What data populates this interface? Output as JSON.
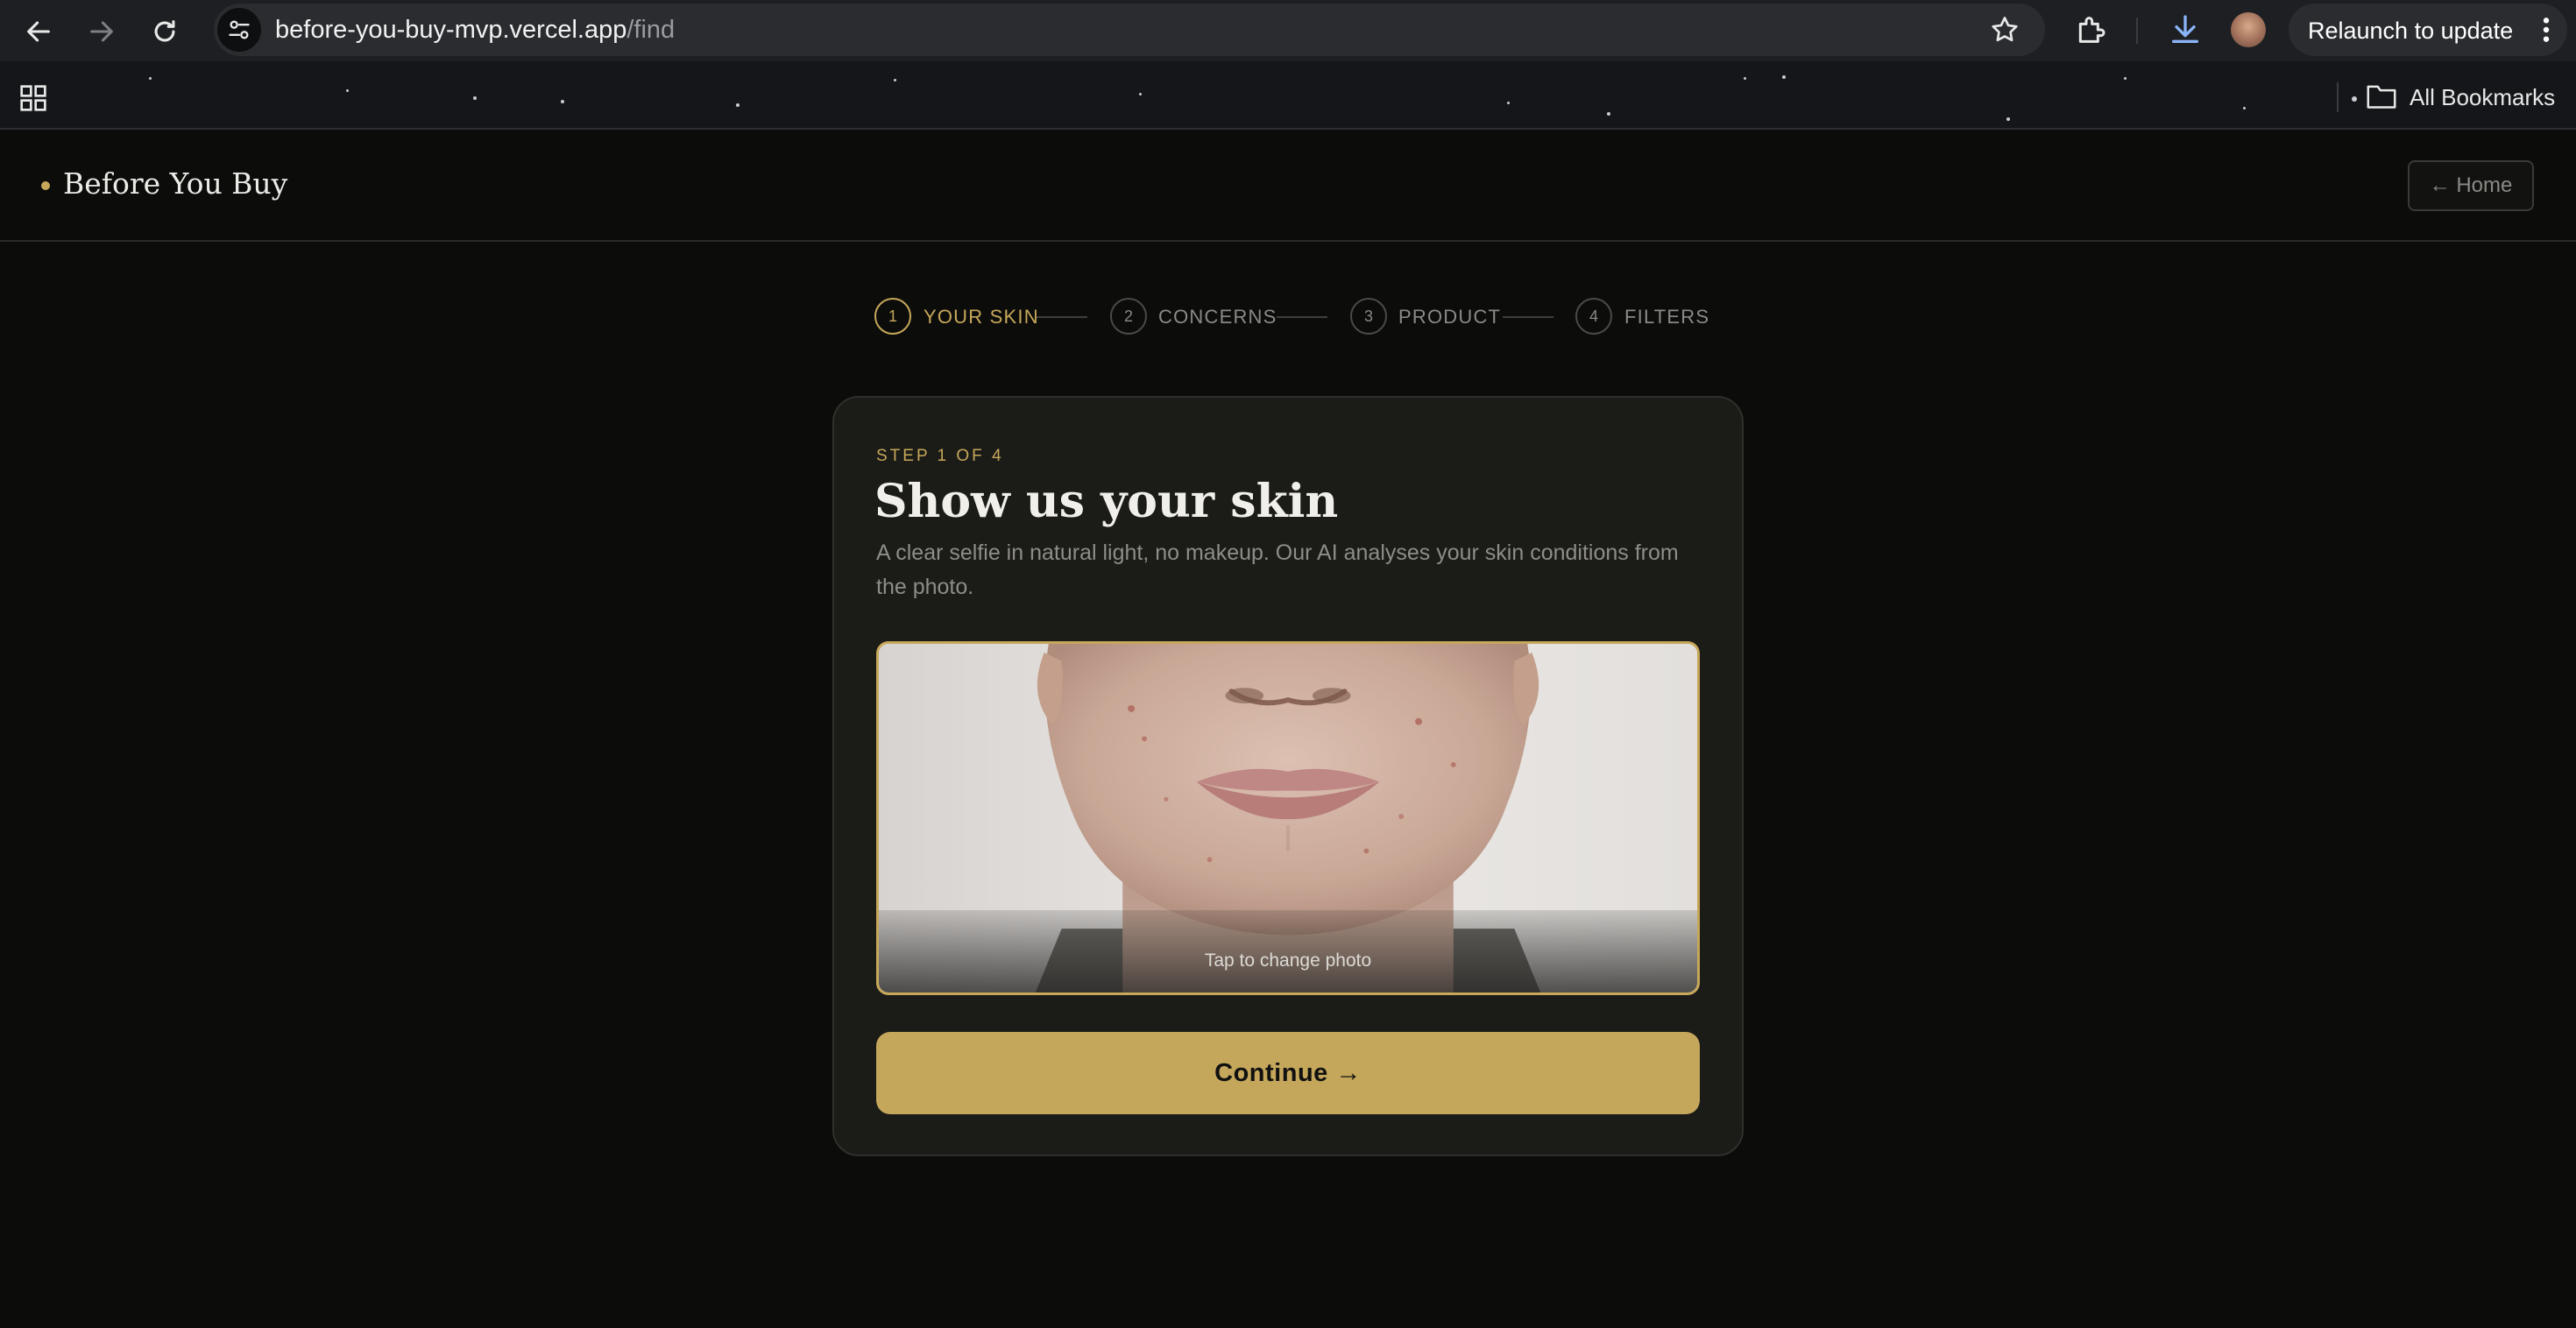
{
  "browser": {
    "url_host": "before-you-buy-mvp.vercel.app",
    "url_path": "/find",
    "relaunch_label": "Relaunch to update",
    "bookmarks_label": "All Bookmarks"
  },
  "header": {
    "brand": "Before You Buy",
    "home_label": "← Home"
  },
  "stepper": {
    "steps": [
      {
        "number": "1",
        "label": "YOUR SKIN",
        "active": true
      },
      {
        "number": "2",
        "label": "CONCERNS",
        "active": false
      },
      {
        "number": "3",
        "label": "PRODUCT",
        "active": false
      },
      {
        "number": "4",
        "label": "FILTERS",
        "active": false
      }
    ]
  },
  "card": {
    "eyebrow": "STEP 1 OF 4",
    "title": "Show us your skin",
    "description": "A clear selfie in natural light, no makeup. Our AI analyses your skin conditions from the photo.",
    "photo_caption": "Tap to change photo",
    "continue_label": "Continue →"
  },
  "colors": {
    "accent": "#c7a85a",
    "button": "#c4a75b",
    "background": "#0c0c0b",
    "card": "#1b1b18"
  }
}
